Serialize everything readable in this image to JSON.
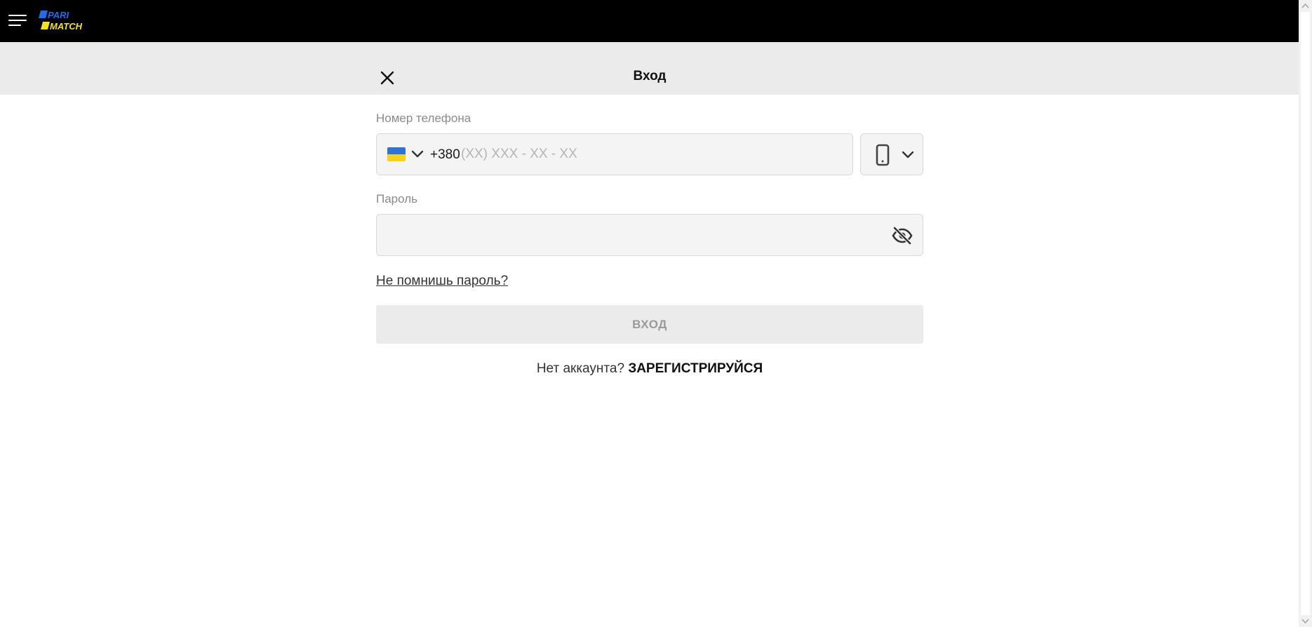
{
  "header": {
    "brand_line1": "PARI",
    "brand_line2": "MATCH",
    "brand_colors": {
      "line1": "#1e6cf2",
      "line2": "#f5e31a"
    }
  },
  "modal": {
    "title": "Вход"
  },
  "phone": {
    "label": "Номер телефона",
    "country_prefix": "+380",
    "placeholder": "(XX) XXX - XX - XX",
    "value": ""
  },
  "password": {
    "label": "Пароль",
    "value": ""
  },
  "forgot_password": "Не помнишь пароль?",
  "login_button": "ВХОД",
  "register": {
    "prompt": "Нет аккаунта?",
    "link": "ЗАРЕГИСТРИРУЙСЯ"
  },
  "icons": {
    "menu": "hamburger-icon",
    "close": "close-icon",
    "flag": "ukraine-flag-icon",
    "device": "smartphone-icon",
    "chevron": "chevron-down-icon",
    "visibility": "eye-off-icon"
  }
}
